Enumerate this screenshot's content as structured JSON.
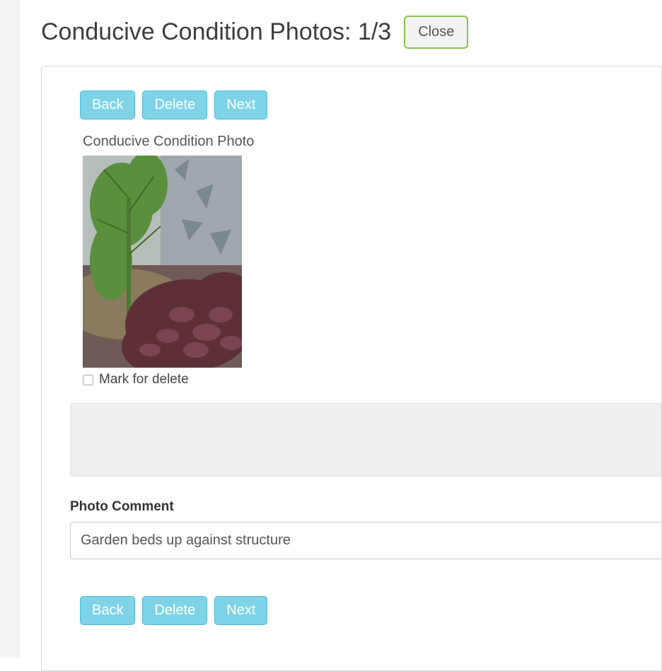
{
  "header": {
    "title": "Conducive Condition Photos: 1/3",
    "close_label": "Close"
  },
  "nav": {
    "back_label": "Back",
    "delete_label": "Delete",
    "next_label": "Next"
  },
  "photo": {
    "section_label": "Conducive Condition Photo",
    "mark_delete_label": "Mark for delete",
    "mark_delete_checked": false
  },
  "comment": {
    "label": "Photo Comment",
    "value": "Garden beds up against structure"
  }
}
